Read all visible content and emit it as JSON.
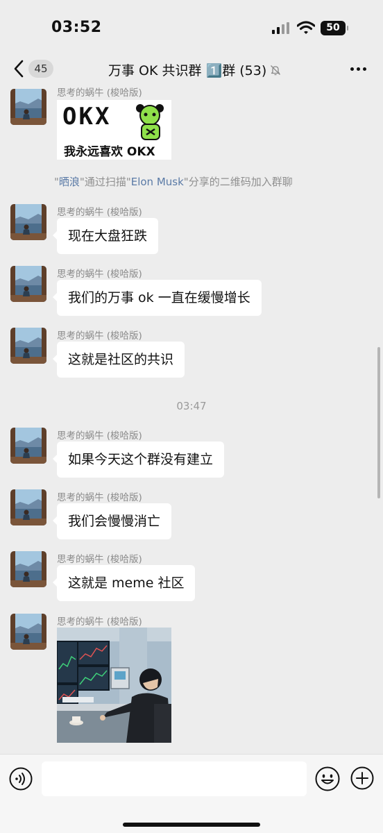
{
  "status_bar": {
    "time": "03:52",
    "battery": "50",
    "icons": [
      "signal-icon",
      "wifi-icon",
      "battery-icon"
    ]
  },
  "header": {
    "back_icon": "chevron-left-icon",
    "unread_count": "45",
    "title": "万事 OK 共识群 1️⃣群 (53)",
    "mute_icon": "bell-slash-icon",
    "more_icon": "ellipsis-icon"
  },
  "messages": [
    {
      "sender": "思考的蜗牛 (梭哈版)",
      "type": "sticker",
      "sticker_logo": "OKX",
      "sticker_caption": "我永远喜欢 OKX"
    },
    {
      "sender": "思考的蜗牛 (梭哈版)",
      "type": "text",
      "text": "现在大盘狂跌"
    },
    {
      "sender": "思考的蜗牛 (梭哈版)",
      "type": "text",
      "text": "我们的万事 ok 一直在缓慢增长"
    },
    {
      "sender": "思考的蜗牛 (梭哈版)",
      "type": "text",
      "text": "这就是社区的共识"
    },
    {
      "sender": "思考的蜗牛 (梭哈版)",
      "type": "text",
      "text": "如果今天这个群没有建立"
    },
    {
      "sender": "思考的蜗牛 (梭哈版)",
      "type": "text",
      "text": "我们会慢慢消亡"
    },
    {
      "sender": "思考的蜗牛 (梭哈版)",
      "type": "text",
      "text": "这就是 meme 社区"
    },
    {
      "sender": "思考的蜗牛 (梭哈版)",
      "type": "image"
    }
  ],
  "system_notice": {
    "q1": "\"",
    "user": "晒浪",
    "mid": "\"通过扫描\"",
    "inviter": "Elon Musk",
    "tail": "\"分享的二维码加入群聊"
  },
  "timestamp": "03:47",
  "input_bar": {
    "voice_icon": "voice-icon",
    "placeholder": "",
    "emoji_icon": "smile-icon",
    "plus_icon": "plus-circle-icon"
  },
  "colors": {
    "background": "#ededed",
    "bubble": "#ffffff",
    "name_link": "#5a7aa6",
    "meta_text": "#8a8a8a",
    "sticker_green": "#8fe04a"
  }
}
